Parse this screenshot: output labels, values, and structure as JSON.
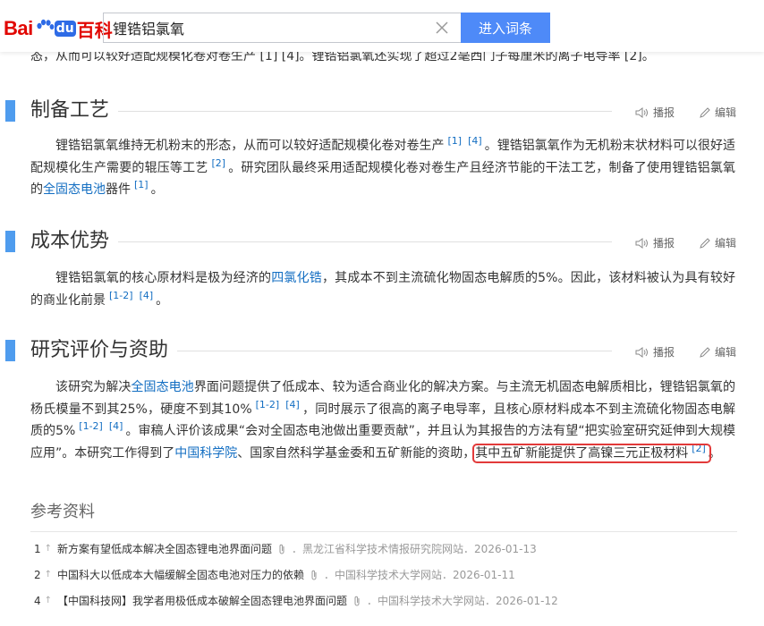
{
  "header": {
    "logo_bai": "Bai",
    "logo_du": "du",
    "logo_baike": "百科",
    "search_value": "锂锆铝氯氧",
    "enter_button": "进入词条"
  },
  "cut_text": "态，从而可以较好适配规模化卷对卷生产 [1] [4]。锂锆铝氯氧还实现了超过2毫西门子每厘米的离子电导率 [2]。",
  "tools": {
    "broadcast": "播报",
    "edit": "编辑"
  },
  "sections": [
    {
      "title": "制备工艺",
      "p1": "锂锆铝氯氧维持无机粉末的形态，从而可以较好适配规模化卷对卷生产",
      "ref1": "[1]",
      "ref2": "[4]",
      "p2": "。锂锆铝氯氧作为无机粉末状材料可以很好适配规模化生产需要的辊压等工艺",
      "ref3": "[2]",
      "p3": "。研究团队最终采用适配规模化卷对卷生产且经济节能的干法工艺，制备了使用锂锆铝氯氧的",
      "link1": "全固态电池",
      "p4": "器件",
      "ref4": "[1]",
      "p5": "。"
    },
    {
      "title": "成本优势",
      "p1": "锂锆铝氯氧的核心原材料是极为经济的",
      "link1": "四氯化锆",
      "p2": "，其成本不到主流硫化物固态电解质的5%。因此，该材料被认为具有较好的商业化前景",
      "ref1": "[1-2]",
      "ref2": "[4]",
      "p3": "。"
    },
    {
      "title": "研究评价与资助",
      "p1": "该研究为解决",
      "link1": "全固态电池",
      "p2": "界面问题提供了低成本、较为适合商业化的解决方案。与主流无机固态电解质相比，锂锆铝氯氧的杨氏模量不到其25%，硬度不到其10%",
      "ref1": "[1-2]",
      "ref2": "[4]",
      "p3": "，同时展示了很高的离子电导率，且核心原材料成本不到主流硫化物固态电解质的5%",
      "ref3": "[1-2]",
      "ref4": "[4]",
      "p4": "。审稿人评价该成果“会对全固态电池做出重要贡献”，并且认为其报告的方法有望“把实验室研究延伸到大规模应用”。本研究工作得到了",
      "link2": "中国科学院",
      "p5": "、国家自然科学基金委和五矿新能的资助，",
      "highlight": "其中五矿新能提供了高镍三元正极材料",
      "ref5": "[2]",
      "p6": "。"
    }
  ],
  "references": {
    "title": "参考资料",
    "items": [
      {
        "num": "1",
        "text": "新方案有望低成本解决全固态锂电池界面问题",
        "src": "．黑龙江省科学技术情报研究院网站．2026-01-13"
      },
      {
        "num": "2",
        "text": "中国科大以低成本大幅缓解全固态电池对压力的依赖",
        "src": "．中国科学技术大学网站．2026-01-11"
      },
      {
        "num": "4",
        "text": "【中国科技网】我学者用极低成本破解全固态锂电池界面问题",
        "src": "．中国科学技术大学网站．2026-01-12"
      }
    ]
  }
}
